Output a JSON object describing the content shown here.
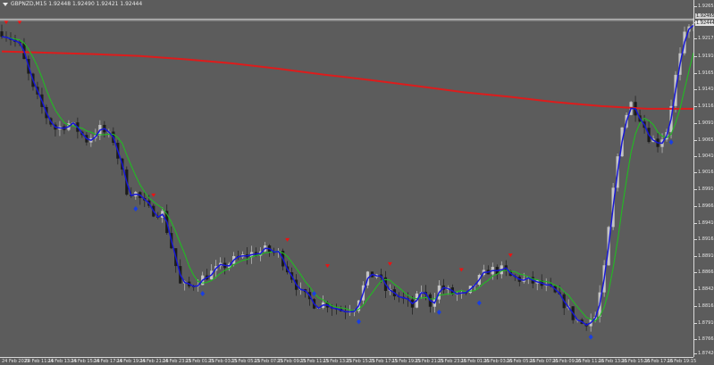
{
  "window": {
    "caption": "GBPNZD,M15  1.92448 1.92490 1.92421 1.92444"
  },
  "price_axis": {
    "ticks": [
      "1.92655",
      "1.92420",
      "1.92175",
      "1.91910",
      "1.91655",
      "1.91410",
      "1.91165",
      "1.90910",
      "1.90655",
      "1.90410",
      "1.90165",
      "1.89910",
      "1.89665",
      "1.89410",
      "1.89165",
      "1.88910",
      "1.88665",
      "1.88420",
      "1.88165",
      "1.87910",
      "1.87665",
      "1.87420"
    ],
    "current_bid": "1.92444",
    "current_ask": "1.92465"
  },
  "time_axis": {
    "ticks": [
      "24 Feb 2021",
      "24 Feb 11:15",
      "24 Feb 13:15",
      "24 Feb 15:15",
      "24 Feb 17:15",
      "24 Feb 19:15",
      "24 Feb 21:15",
      "24 Feb 23:15",
      "25 Feb 01:15",
      "25 Feb 03:15",
      "25 Feb 05:15",
      "25 Feb 07:15",
      "25 Feb 09:15",
      "25 Feb 11:15",
      "25 Feb 13:15",
      "25 Feb 15:15",
      "25 Feb 17:15",
      "25 Feb 19:15",
      "25 Feb 21:15",
      "25 Feb 23:15",
      "26 Feb 01:15",
      "26 Feb 03:15",
      "26 Feb 05:15",
      "26 Feb 07:15",
      "26 Feb 09:15",
      "26 Feb 11:15",
      "26 Feb 13:15",
      "26 Feb 15:15",
      "26 Feb 17:15",
      "26 Feb 19:15"
    ]
  },
  "colors": {
    "background": "#5c5c5c",
    "bull_candle": "#c4c4c4",
    "bear_candle": "#1c1c1c",
    "slow_ma": "#dd1c1c",
    "mid_ma": "#22bb22",
    "fast_ma": "#1717d6",
    "sell_arrow": "#ee1111",
    "buy_arrow": "#1a3fe0",
    "grid_line": "#cfcfcf"
  },
  "chart_data": {
    "type": "candlestick",
    "symbol": "GBPNZD",
    "timeframe": "M15",
    "ohlc_last": {
      "open": 1.92448,
      "high": 1.9249,
      "low": 1.92421,
      "close": 1.92444
    },
    "ylim": [
      1.874,
      1.9275
    ],
    "close_path": [
      {
        "t": 0,
        "y": 1.9228
      },
      {
        "t": 2,
        "y": 1.9218
      },
      {
        "t": 4,
        "y": 1.9205
      },
      {
        "t": 7,
        "y": 1.914
      },
      {
        "t": 10,
        "y": 1.91
      },
      {
        "t": 12,
        "y": 1.9082
      },
      {
        "t": 15,
        "y": 1.909
      },
      {
        "t": 17,
        "y": 1.908
      },
      {
        "t": 19,
        "y": 1.9065
      },
      {
        "t": 22,
        "y": 1.9082
      },
      {
        "t": 25,
        "y": 1.9065
      },
      {
        "t": 28,
        "y": 1.899
      },
      {
        "t": 30,
        "y": 1.8985
      },
      {
        "t": 33,
        "y": 1.896
      },
      {
        "t": 36,
        "y": 1.8955
      },
      {
        "t": 38,
        "y": 1.8905
      },
      {
        "t": 40,
        "y": 1.8848
      },
      {
        "t": 42,
        "y": 1.8845
      },
      {
        "t": 44,
        "y": 1.8855
      },
      {
        "t": 48,
        "y": 1.887
      },
      {
        "t": 52,
        "y": 1.8885
      },
      {
        "t": 56,
        "y": 1.8895
      },
      {
        "t": 59,
        "y": 1.89
      },
      {
        "t": 62,
        "y": 1.8895
      },
      {
        "t": 65,
        "y": 1.886
      },
      {
        "t": 67,
        "y": 1.8835
      },
      {
        "t": 70,
        "y": 1.882
      },
      {
        "t": 73,
        "y": 1.882
      },
      {
        "t": 76,
        "y": 1.881
      },
      {
        "t": 79,
        "y": 1.8815
      },
      {
        "t": 82,
        "y": 1.886
      },
      {
        "t": 84,
        "y": 1.8865
      },
      {
        "t": 86,
        "y": 1.884
      },
      {
        "t": 89,
        "y": 1.883
      },
      {
        "t": 92,
        "y": 1.8815
      },
      {
        "t": 94,
        "y": 1.884
      },
      {
        "t": 96,
        "y": 1.882
      },
      {
        "t": 98,
        "y": 1.8845
      },
      {
        "t": 101,
        "y": 1.8835
      },
      {
        "t": 104,
        "y": 1.883
      },
      {
        "t": 106,
        "y": 1.885
      },
      {
        "t": 109,
        "y": 1.887
      },
      {
        "t": 112,
        "y": 1.887
      },
      {
        "t": 114,
        "y": 1.886
      },
      {
        "t": 117,
        "y": 1.8855
      },
      {
        "t": 120,
        "y": 1.885
      },
      {
        "t": 123,
        "y": 1.884
      },
      {
        "t": 126,
        "y": 1.882
      },
      {
        "t": 128,
        "y": 1.88
      },
      {
        "t": 130,
        "y": 1.879
      },
      {
        "t": 133,
        "y": 1.88
      },
      {
        "t": 135,
        "y": 1.887
      },
      {
        "t": 137,
        "y": 1.899
      },
      {
        "t": 139,
        "y": 1.909
      },
      {
        "t": 141,
        "y": 1.912
      },
      {
        "t": 143,
        "y": 1.91
      },
      {
        "t": 145,
        "y": 1.907
      },
      {
        "t": 147,
        "y": 1.906
      },
      {
        "t": 149,
        "y": 1.908
      },
      {
        "t": 151,
        "y": 1.916
      },
      {
        "t": 153,
        "y": 1.922
      },
      {
        "t": 155,
        "y": 1.9244
      }
    ],
    "series": [
      {
        "role": "slow",
        "values": [
          1.9198,
          1.9196,
          1.9194,
          1.9191,
          1.9186,
          1.918,
          1.9172,
          1.9163,
          1.9155,
          1.9146,
          1.9137,
          1.913,
          1.9122,
          1.9116,
          1.9112,
          1.9112
        ]
      },
      {
        "role": "mid"
      },
      {
        "role": "fast"
      }
    ],
    "sell_signals": [
      {
        "t": 1,
        "y": 1.9244
      },
      {
        "t": 4,
        "y": 1.9244
      },
      {
        "t": 34,
        "y": 1.8985
      },
      {
        "t": 64,
        "y": 1.8918
      },
      {
        "t": 73,
        "y": 1.8879
      },
      {
        "t": 87,
        "y": 1.8882
      },
      {
        "t": 103,
        "y": 1.8873
      },
      {
        "t": 114,
        "y": 1.8895
      }
    ],
    "buy_signals": [
      {
        "t": 30,
        "y": 1.8962
      },
      {
        "t": 45,
        "y": 1.8835
      },
      {
        "t": 70,
        "y": 1.8835
      },
      {
        "t": 80,
        "y": 1.8793
      },
      {
        "t": 98,
        "y": 1.8807
      },
      {
        "t": 107,
        "y": 1.8821
      },
      {
        "t": 132,
        "y": 1.877
      },
      {
        "t": 150,
        "y": 1.9062
      }
    ],
    "grid": false
  }
}
